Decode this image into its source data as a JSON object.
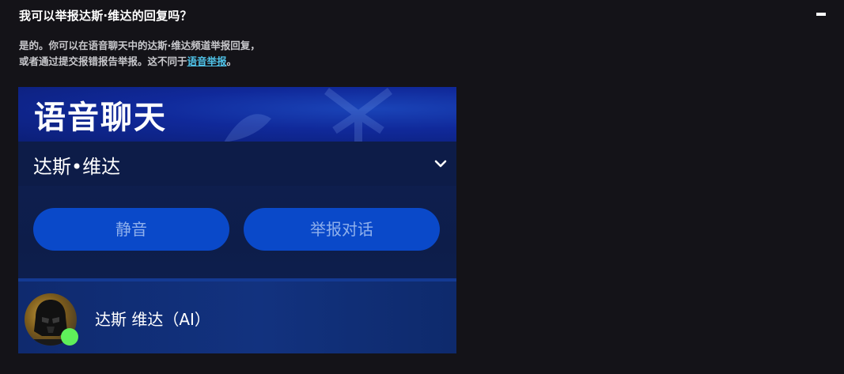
{
  "faq": {
    "question": "我可以举报达斯·维达的回复吗？",
    "collapse_icon": "minus-icon",
    "answer_line1": "是的。你可以在语音聊天中的达斯·维达频道举报回复，",
    "answer_line2_prefix": "或者通过提交报错报告举报。这不同于",
    "answer_link": "语音举报",
    "answer_line2_suffix": "。"
  },
  "screenshot": {
    "title": "语音聊天",
    "channel_name": "达斯•维达",
    "chevron_icon": "chevron-down-icon",
    "mute_button": "静音",
    "report_button": "举报对话",
    "member_name": "达斯 维达（AI）",
    "avatar_icon": "darth-vader-avatar",
    "status_color": "#5ff05a",
    "accent_color": "#0a49c9"
  }
}
